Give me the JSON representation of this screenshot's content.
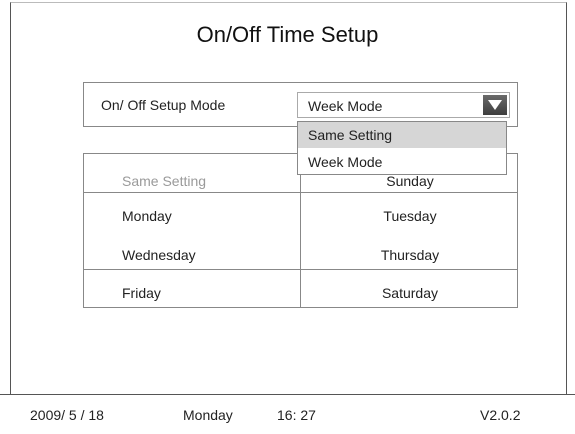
{
  "title": "On/Off Time Setup",
  "mode": {
    "label": "On/ Off Setup Mode",
    "selected": "Week Mode",
    "options": [
      "Same Setting",
      "Week Mode"
    ],
    "highlighted_option": "Same Setting"
  },
  "table": {
    "same_setting": "Same Setting",
    "days": {
      "sunday": "Sunday",
      "monday": "Monday",
      "tuesday": "Tuesday",
      "wednesday": "Wednesday",
      "thursday": "Thursday",
      "friday": "Friday",
      "saturday": "Saturday"
    }
  },
  "status": {
    "date": "2009/ 5 / 18",
    "weekday": "Monday",
    "time": "16: 27",
    "version": "V2.0.2"
  },
  "icons": {
    "dropdown_arrow": "triangle-down-icon"
  },
  "colors": {
    "highlight": "#d6d6d6",
    "disabled_text": "#9a9a9a",
    "arrow_button": "#4a4a4a"
  }
}
